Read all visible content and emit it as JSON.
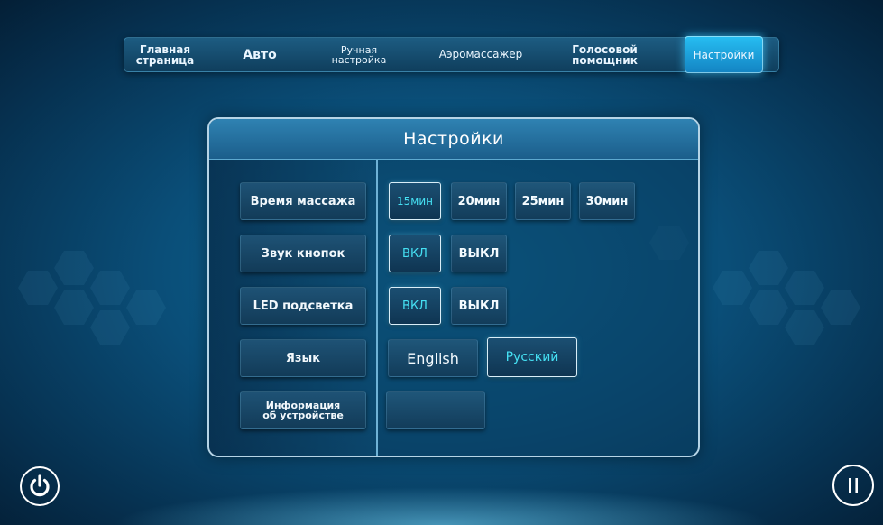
{
  "nav": {
    "items": [
      {
        "label": "Главная\nстраница",
        "active": false
      },
      {
        "label": "Авто",
        "active": false
      },
      {
        "label": "Ручная\nнастройка",
        "active": false
      },
      {
        "label": "Аэромассажер",
        "active": false
      },
      {
        "label": "Голосовой\nпомощник",
        "active": false
      },
      {
        "label": "Настройки",
        "active": true
      }
    ]
  },
  "panel": {
    "title": "Настройки",
    "rows": [
      {
        "label": "Время массажа",
        "options": [
          "15мин",
          "20мин",
          "25мин",
          "30мин"
        ],
        "selected": "15мин"
      },
      {
        "label": "Звук кнопок",
        "options": [
          "ВКЛ",
          "ВЫКЛ"
        ],
        "selected": "ВКЛ"
      },
      {
        "label": "LED подсветка",
        "options": [
          "ВКЛ",
          "ВЫКЛ"
        ],
        "selected": "ВКЛ"
      },
      {
        "label": "Язык",
        "options": [
          "English",
          "Русский"
        ],
        "selected": "Русский"
      },
      {
        "label": "Информация\nоб устройстве",
        "options": [
          ""
        ],
        "selected": null
      }
    ]
  },
  "controls": {
    "power_icon": "power-icon",
    "pause_icon": "pause-icon"
  },
  "colors": {
    "accent": "#1fb4ec",
    "selected_text": "#45e0f3",
    "panel_border": "#b6d4e6"
  }
}
